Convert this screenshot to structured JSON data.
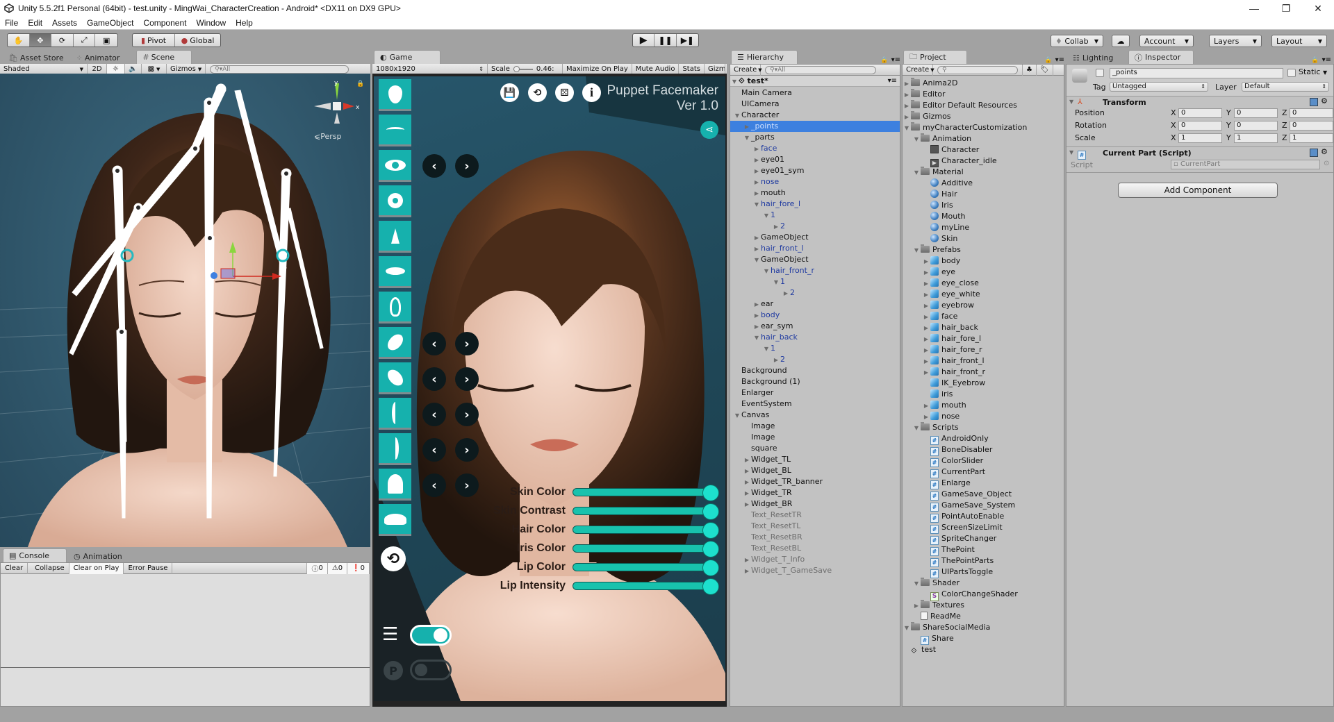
{
  "window": {
    "title": "Unity 5.5.2f1 Personal (64bit) - test.unity - MingWai_CharacterCreation - Android* <DX11 on DX9 GPU>",
    "controls": {
      "minimize": "—",
      "restore": "❐",
      "close": "✕"
    }
  },
  "menu": [
    "File",
    "Edit",
    "Assets",
    "GameObject",
    "Component",
    "Window",
    "Help"
  ],
  "toolbar": {
    "transform_tools": [
      "hand-tool",
      "move-tool",
      "rotate-tool",
      "scale-tool",
      "rect-tool"
    ],
    "active_tool": "move-tool",
    "pivot_label": "Pivot",
    "global_label": "Global",
    "play_controls": [
      "play",
      "pause",
      "step"
    ],
    "collab_label": "Collab",
    "account_label": "Account",
    "layers_label": "Layers",
    "layout_label": "Layout"
  },
  "scene_panel": {
    "tabs": [
      "Asset Store",
      "Animator",
      "Scene"
    ],
    "active_tab": "Scene",
    "shading_mode": "Shaded",
    "mode_2d": "2D",
    "gizmos_label": "Gizmos",
    "search_placeholder": "All",
    "projection_label": "Persp",
    "axis_labels": {
      "x": "x",
      "y": "y"
    }
  },
  "console_panel": {
    "tabs": [
      "Console",
      "Animation"
    ],
    "active_tab": "Console",
    "buttons": [
      "Clear",
      "Collapse",
      "Clear on Play",
      "Error Pause"
    ],
    "counts": {
      "info": "0",
      "warning": "0",
      "error": "0"
    }
  },
  "game_panel": {
    "tab": "Game",
    "resolution": "1080x1920",
    "scale_label": "Scale",
    "scale_value": "0.46:",
    "buttons": [
      "Maximize On Play",
      "Mute Audio",
      "Stats",
      "Gizmos"
    ],
    "app_title": "Puppet Facemaker",
    "app_version": "Ver 1.0",
    "top_icons": [
      "save-icon",
      "reset-icon",
      "dice-icon",
      "info-icon"
    ],
    "part_buttons": [
      "face",
      "eyebrow",
      "eye",
      "iris",
      "nose",
      "mouth",
      "ear",
      "hair-front-left",
      "hair-front-right",
      "hair-fore-left",
      "hair-fore-right",
      "hair-back",
      "body"
    ],
    "sliders": [
      {
        "label": "Skin Color",
        "value": 1.0
      },
      {
        "label": "Skin Contrast",
        "value": 1.0
      },
      {
        "label": "Hair Color",
        "value": 1.0
      },
      {
        "label": "Iris Color",
        "value": 1.0
      },
      {
        "label": "Lip Color",
        "value": 1.0
      },
      {
        "label": "Lip Intensity",
        "value": 1.0
      }
    ],
    "list_toggle_on": true,
    "points_toggle_on": false,
    "accent_color": "#16b1ad"
  },
  "hierarchy": {
    "tab": "Hierarchy",
    "create_label": "Create",
    "search_placeholder": "All",
    "scene_name": "test*",
    "items": [
      {
        "label": "Main Camera",
        "depth": 1,
        "arrow": "",
        "style": "normal"
      },
      {
        "label": "UICamera",
        "depth": 1,
        "arrow": "",
        "style": "normal"
      },
      {
        "label": "Character",
        "depth": 1,
        "arrow": "open",
        "style": "normal"
      },
      {
        "label": "_points",
        "depth": 2,
        "arrow": "closed",
        "style": "selected"
      },
      {
        "label": "_parts",
        "depth": 2,
        "arrow": "open",
        "style": "normal"
      },
      {
        "label": "face",
        "depth": 3,
        "arrow": "closed",
        "style": "prefab"
      },
      {
        "label": "eye01",
        "depth": 3,
        "arrow": "closed",
        "style": "normal"
      },
      {
        "label": "eye01_sym",
        "depth": 3,
        "arrow": "closed",
        "style": "normal"
      },
      {
        "label": "nose",
        "depth": 3,
        "arrow": "closed",
        "style": "prefab"
      },
      {
        "label": "mouth",
        "depth": 3,
        "arrow": "closed",
        "style": "normal"
      },
      {
        "label": "hair_fore_l",
        "depth": 3,
        "arrow": "open",
        "style": "prefab"
      },
      {
        "label": "1",
        "depth": 4,
        "arrow": "open",
        "style": "prefab"
      },
      {
        "label": "2",
        "depth": 5,
        "arrow": "closed",
        "style": "prefab"
      },
      {
        "label": "GameObject",
        "depth": 3,
        "arrow": "closed",
        "style": "normal"
      },
      {
        "label": "hair_front_l",
        "depth": 3,
        "arrow": "closed",
        "style": "prefab"
      },
      {
        "label": "GameObject",
        "depth": 3,
        "arrow": "open",
        "style": "normal"
      },
      {
        "label": "hair_front_r",
        "depth": 4,
        "arrow": "open",
        "style": "prefab"
      },
      {
        "label": "1",
        "depth": 5,
        "arrow": "open",
        "style": "prefab"
      },
      {
        "label": "2",
        "depth": 6,
        "arrow": "closed",
        "style": "prefab"
      },
      {
        "label": "ear",
        "depth": 3,
        "arrow": "closed",
        "style": "normal"
      },
      {
        "label": "body",
        "depth": 3,
        "arrow": "closed",
        "style": "prefab"
      },
      {
        "label": "ear_sym",
        "depth": 3,
        "arrow": "closed",
        "style": "normal"
      },
      {
        "label": "hair_back",
        "depth": 3,
        "arrow": "open",
        "style": "prefab"
      },
      {
        "label": "1",
        "depth": 4,
        "arrow": "open",
        "style": "prefab"
      },
      {
        "label": "2",
        "depth": 5,
        "arrow": "closed",
        "style": "prefab"
      },
      {
        "label": "Background",
        "depth": 1,
        "arrow": "",
        "style": "normal"
      },
      {
        "label": "Background (1)",
        "depth": 1,
        "arrow": "",
        "style": "normal"
      },
      {
        "label": "Enlarger",
        "depth": 1,
        "arrow": "",
        "style": "normal"
      },
      {
        "label": "EventSystem",
        "depth": 1,
        "arrow": "",
        "style": "normal"
      },
      {
        "label": "Canvas",
        "depth": 1,
        "arrow": "open",
        "style": "normal"
      },
      {
        "label": "Image",
        "depth": 2,
        "arrow": "",
        "style": "normal"
      },
      {
        "label": "Image",
        "depth": 2,
        "arrow": "",
        "style": "normal"
      },
      {
        "label": "square",
        "depth": 2,
        "arrow": "",
        "style": "normal"
      },
      {
        "label": "Widget_TL",
        "depth": 2,
        "arrow": "closed",
        "style": "normal"
      },
      {
        "label": "Widget_BL",
        "depth": 2,
        "arrow": "closed",
        "style": "normal"
      },
      {
        "label": "Widget_TR_banner",
        "depth": 2,
        "arrow": "closed",
        "style": "normal"
      },
      {
        "label": "Widget_TR",
        "depth": 2,
        "arrow": "closed",
        "style": "normal"
      },
      {
        "label": "Widget_BR",
        "depth": 2,
        "arrow": "closed",
        "style": "normal"
      },
      {
        "label": "Text_ResetTR",
        "depth": 2,
        "arrow": "",
        "style": "inactive"
      },
      {
        "label": "Text_ResetTL",
        "depth": 2,
        "arrow": "",
        "style": "inactive"
      },
      {
        "label": "Text_ResetBR",
        "depth": 2,
        "arrow": "",
        "style": "inactive"
      },
      {
        "label": "Text_ResetBL",
        "depth": 2,
        "arrow": "",
        "style": "inactive"
      },
      {
        "label": "Widget_T_Info",
        "depth": 2,
        "arrow": "closed",
        "style": "inactive"
      },
      {
        "label": "Widget_T_GameSave",
        "depth": 2,
        "arrow": "closed",
        "style": "inactive"
      }
    ]
  },
  "project": {
    "tab": "Project",
    "create_label": "Create",
    "search_placeholder": "",
    "items": [
      {
        "label": "Anima2D",
        "depth": 0,
        "arrow": "closed",
        "icon": "folder"
      },
      {
        "label": "Editor",
        "depth": 0,
        "arrow": "closed",
        "icon": "folder"
      },
      {
        "label": "Editor Default Resources",
        "depth": 0,
        "arrow": "closed",
        "icon": "folder"
      },
      {
        "label": "Gizmos",
        "depth": 0,
        "arrow": "closed",
        "icon": "folder"
      },
      {
        "label": "myCharacterCustomization",
        "depth": 0,
        "arrow": "open",
        "icon": "folder"
      },
      {
        "label": "Animation",
        "depth": 1,
        "arrow": "open",
        "icon": "folder"
      },
      {
        "label": "Character",
        "depth": 2,
        "arrow": "",
        "icon": "animator"
      },
      {
        "label": "Character_idle",
        "depth": 2,
        "arrow": "",
        "icon": "animation"
      },
      {
        "label": "Material",
        "depth": 1,
        "arrow": "open",
        "icon": "folder"
      },
      {
        "label": "Additive",
        "depth": 2,
        "arrow": "",
        "icon": "material"
      },
      {
        "label": "Hair",
        "depth": 2,
        "arrow": "",
        "icon": "material"
      },
      {
        "label": "Iris",
        "depth": 2,
        "arrow": "",
        "icon": "material"
      },
      {
        "label": "Mouth",
        "depth": 2,
        "arrow": "",
        "icon": "material"
      },
      {
        "label": "myLine",
        "depth": 2,
        "arrow": "",
        "icon": "material"
      },
      {
        "label": "Skin",
        "depth": 2,
        "arrow": "",
        "icon": "material"
      },
      {
        "label": "Prefabs",
        "depth": 1,
        "arrow": "open",
        "icon": "folder"
      },
      {
        "label": "body",
        "depth": 2,
        "arrow": "closed",
        "icon": "prefab"
      },
      {
        "label": "eye",
        "depth": 2,
        "arrow": "closed",
        "icon": "prefab"
      },
      {
        "label": "eye_close",
        "depth": 2,
        "arrow": "closed",
        "icon": "prefab"
      },
      {
        "label": "eye_white",
        "depth": 2,
        "arrow": "closed",
        "icon": "prefab"
      },
      {
        "label": "eyebrow",
        "depth": 2,
        "arrow": "closed",
        "icon": "prefab"
      },
      {
        "label": "face",
        "depth": 2,
        "arrow": "closed",
        "icon": "prefab"
      },
      {
        "label": "hair_back",
        "depth": 2,
        "arrow": "closed",
        "icon": "prefab"
      },
      {
        "label": "hair_fore_l",
        "depth": 2,
        "arrow": "closed",
        "icon": "prefab"
      },
      {
        "label": "hair_fore_r",
        "depth": 2,
        "arrow": "closed",
        "icon": "prefab"
      },
      {
        "label": "hair_front_l",
        "depth": 2,
        "arrow": "closed",
        "icon": "prefab"
      },
      {
        "label": "hair_front_r",
        "depth": 2,
        "arrow": "closed",
        "icon": "prefab"
      },
      {
        "label": "IK_Eyebrow",
        "depth": 2,
        "arrow": "",
        "icon": "prefab"
      },
      {
        "label": "iris",
        "depth": 2,
        "arrow": "",
        "icon": "prefab"
      },
      {
        "label": "mouth",
        "depth": 2,
        "arrow": "closed",
        "icon": "prefab"
      },
      {
        "label": "nose",
        "depth": 2,
        "arrow": "closed",
        "icon": "prefab"
      },
      {
        "label": "Scripts",
        "depth": 1,
        "arrow": "open",
        "icon": "folder"
      },
      {
        "label": "AndroidOnly",
        "depth": 2,
        "arrow": "",
        "icon": "script"
      },
      {
        "label": "BoneDisabler",
        "depth": 2,
        "arrow": "",
        "icon": "script"
      },
      {
        "label": "ColorSlider",
        "depth": 2,
        "arrow": "",
        "icon": "script"
      },
      {
        "label": "CurrentPart",
        "depth": 2,
        "arrow": "",
        "icon": "script"
      },
      {
        "label": "Enlarge",
        "depth": 2,
        "arrow": "",
        "icon": "script"
      },
      {
        "label": "GameSave_Object",
        "depth": 2,
        "arrow": "",
        "icon": "script"
      },
      {
        "label": "GameSave_System",
        "depth": 2,
        "arrow": "",
        "icon": "script"
      },
      {
        "label": "PointAutoEnable",
        "depth": 2,
        "arrow": "",
        "icon": "script"
      },
      {
        "label": "ScreenSizeLimit",
        "depth": 2,
        "arrow": "",
        "icon": "script"
      },
      {
        "label": "SpriteChanger",
        "depth": 2,
        "arrow": "",
        "icon": "script"
      },
      {
        "label": "ThePoint",
        "depth": 2,
        "arrow": "",
        "icon": "script"
      },
      {
        "label": "ThePointParts",
        "depth": 2,
        "arrow": "",
        "icon": "script"
      },
      {
        "label": "UIPartsToggle",
        "depth": 2,
        "arrow": "",
        "icon": "script"
      },
      {
        "label": "Shader",
        "depth": 1,
        "arrow": "open",
        "icon": "folder"
      },
      {
        "label": "ColorChangeShader",
        "depth": 2,
        "arrow": "",
        "icon": "shader"
      },
      {
        "label": "Textures",
        "depth": 1,
        "arrow": "closed",
        "icon": "folder"
      },
      {
        "label": "ReadMe",
        "depth": 1,
        "arrow": "",
        "icon": "text"
      },
      {
        "label": "ShareSocialMedia",
        "depth": 0,
        "arrow": "open",
        "icon": "folder"
      },
      {
        "label": "Share",
        "depth": 1,
        "arrow": "",
        "icon": "script"
      },
      {
        "label": "test",
        "depth": 0,
        "arrow": "",
        "icon": "scene"
      }
    ]
  },
  "inspector": {
    "tabs": [
      "Lighting",
      "Inspector"
    ],
    "active_tab": "Inspector",
    "object_name": "_points",
    "active_checked": false,
    "static_label": "Static",
    "tag_label": "Tag",
    "tag_value": "Untagged",
    "layer_label": "Layer",
    "layer_value": "Default",
    "transform": {
      "title": "Transform",
      "rows": [
        {
          "label": "Position",
          "x": "0",
          "y": "0",
          "z": "0"
        },
        {
          "label": "Rotation",
          "x": "0",
          "y": "0",
          "z": "0"
        },
        {
          "label": "Scale",
          "x": "1",
          "y": "1",
          "z": "1"
        }
      ]
    },
    "script_component": {
      "title": "Current Part (Script)",
      "script_label": "Script",
      "script_value": "CurrentPart"
    },
    "add_component_label": "Add Component"
  }
}
